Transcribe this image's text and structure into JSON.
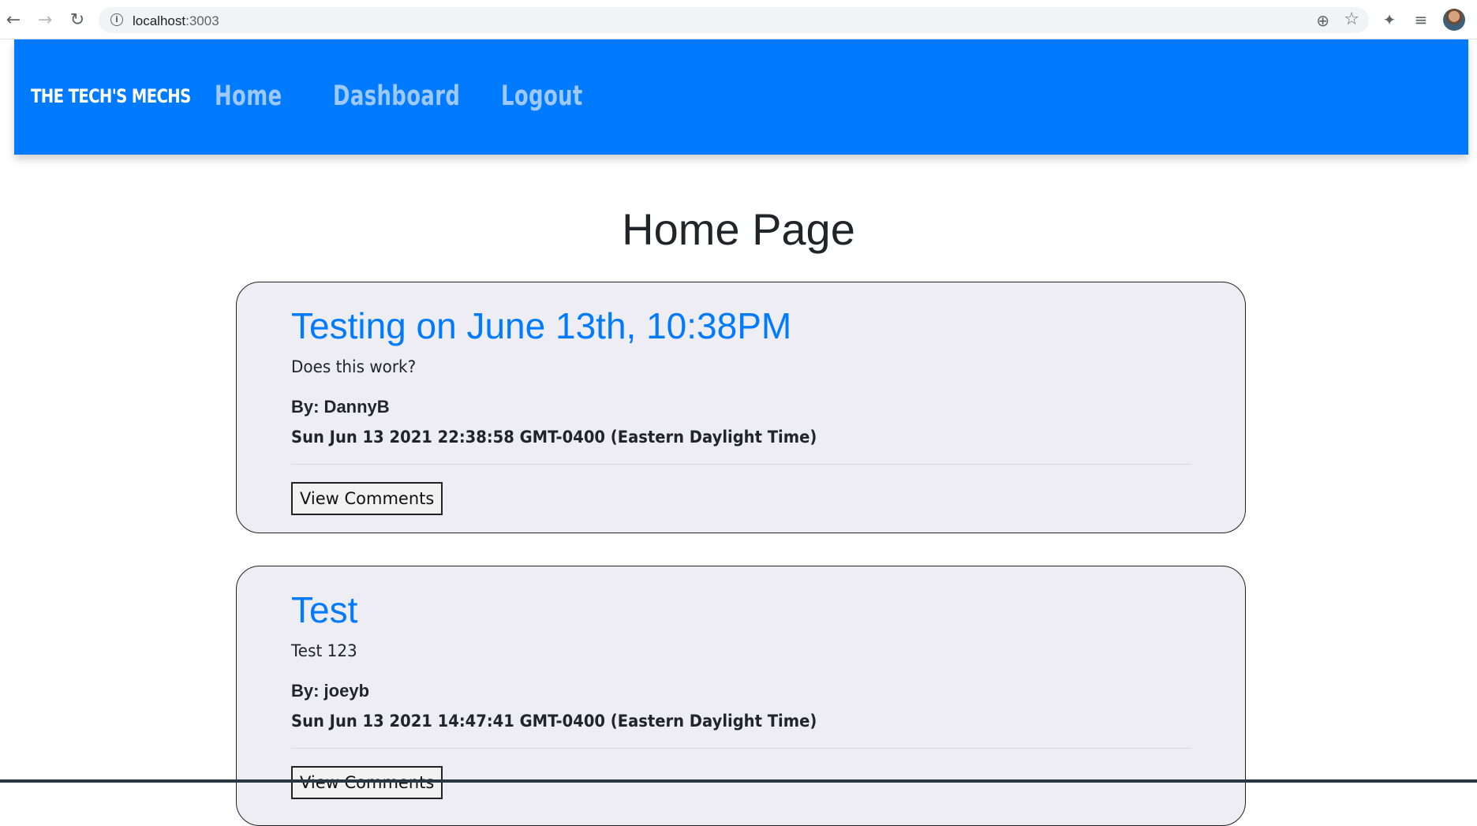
{
  "browser": {
    "url_host": "localhost",
    "url_port": ":3003",
    "icons": {
      "back": "arrow-left",
      "forward": "arrow-right",
      "reload": "reload",
      "info": "info",
      "zoom": "zoom-in",
      "bookmark": "star",
      "extensions": "puzzle",
      "media": "media-queue",
      "profile": "avatar"
    }
  },
  "header": {
    "brand": "THE TECH'S MECHS",
    "nav": [
      {
        "label": "Home"
      },
      {
        "label": "Dashboard"
      },
      {
        "label": "Logout"
      }
    ],
    "background_color": "#007bff",
    "link_color": "#9ec9ff"
  },
  "main": {
    "title": "Home Page",
    "posts": [
      {
        "title": "Testing on June 13th, 10:38PM",
        "content": "Does this work?",
        "author": "By: DannyB",
        "date": "Sun Jun 13 2021 22:38:58 GMT-0400 (Eastern Daylight Time)",
        "button": "View Comments"
      },
      {
        "title": "Test",
        "content": "Test 123",
        "author": "By: joeyb",
        "date": "Sun Jun 13 2021 14:47:41 GMT-0400 (Eastern Daylight Time)",
        "button": "View Comments"
      }
    ],
    "card_background": "#eeedf3",
    "accent_color": "#007bff"
  }
}
